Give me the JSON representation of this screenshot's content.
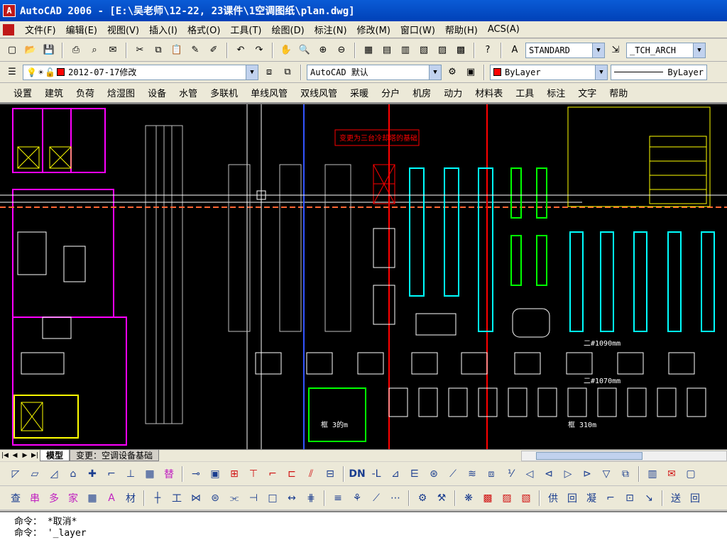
{
  "window": {
    "title": "AutoCAD 2006 - [E:\\吴老师\\12-22, 23课件\\1空调图纸\\plan.dwg]"
  },
  "menu": [
    "文件(F)",
    "编辑(E)",
    "视图(V)",
    "插入(I)",
    "格式(O)",
    "工具(T)",
    "绘图(D)",
    "标注(N)",
    "修改(M)",
    "窗口(W)",
    "帮助(H)",
    "ACS(A)"
  ],
  "toolbar": {
    "text_style": "STANDARD",
    "dim_style": "_TCH_ARCH",
    "layer": "2012-07-17修改",
    "workspace": "AutoCAD 默认",
    "color": "ByLayer",
    "color_swatch": "#ff0000",
    "linetype": "ByLayer"
  },
  "tch_menu": [
    "设置",
    "建筑",
    "负荷",
    "焓湿图",
    "设备",
    "水管",
    "多联机",
    "单线风管",
    "双线风管",
    "采暖",
    "分户",
    "机房",
    "动力",
    "材料表",
    "工具",
    "标注",
    "文字",
    "帮助"
  ],
  "tabs": {
    "model": "模型",
    "layout": "变更：空调设备基础"
  },
  "drawing": {
    "annotation_red": "变更为三台冷却塔的基础",
    "dim_1": "二#1090mm",
    "dim_2": "二#1070mm",
    "dim_3": "框 310m",
    "label_w": "框 3的m"
  },
  "command": {
    "line1_prompt": "命令：",
    "line1_text": "*取消*",
    "line2_prompt": "命令：",
    "line2_text": "'_layer"
  },
  "colors": {
    "canvas": "#000000",
    "magenta": "#ff00ff",
    "yellow": "#ffff00",
    "cyan": "#00ffff",
    "red": "#ff0000",
    "green": "#00ff00",
    "blue": "#3355ff"
  }
}
